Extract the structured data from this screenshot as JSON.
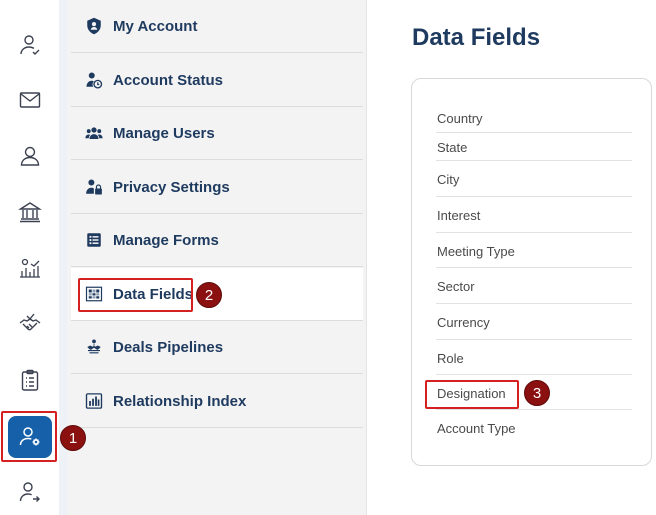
{
  "rail": {
    "items": [
      {
        "icon": "user-check-icon"
      },
      {
        "icon": "mail-icon"
      },
      {
        "icon": "person-icon"
      },
      {
        "icon": "bank-icon"
      },
      {
        "icon": "chart-settings-icon"
      },
      {
        "icon": "handshake-icon"
      },
      {
        "icon": "clipboard-list-icon"
      },
      {
        "icon": "user-settings-icon"
      },
      {
        "icon": "user-share-icon"
      }
    ],
    "active_index": 7
  },
  "menu": {
    "items": [
      {
        "label": "My Account",
        "icon": "shield-user-icon"
      },
      {
        "label": "Account Status",
        "icon": "user-clock-icon"
      },
      {
        "label": "Manage Users",
        "icon": "users-icon"
      },
      {
        "label": "Privacy Settings",
        "icon": "user-lock-icon"
      },
      {
        "label": "Manage Forms",
        "icon": "form-list-icon"
      },
      {
        "label": "Data Fields",
        "icon": "data-grid-icon"
      },
      {
        "label": "Deals Pipelines",
        "icon": "pipeline-icon"
      },
      {
        "label": "Relationship Index",
        "icon": "bar-chart-icon"
      }
    ],
    "active_label": "Data Fields"
  },
  "content": {
    "title": "Data Fields",
    "fields": [
      "Country",
      "State",
      "City",
      "Interest",
      "Meeting Type",
      "Sector",
      "Currency",
      "Role",
      "Designation",
      "Account Type"
    ]
  },
  "callouts": {
    "one": "1",
    "two": "2",
    "three": "3"
  },
  "colors": {
    "accent": "#1560a8",
    "heading": "#1e3a5f",
    "callout_border": "#d42020",
    "callout_badge": "#8b1010"
  }
}
